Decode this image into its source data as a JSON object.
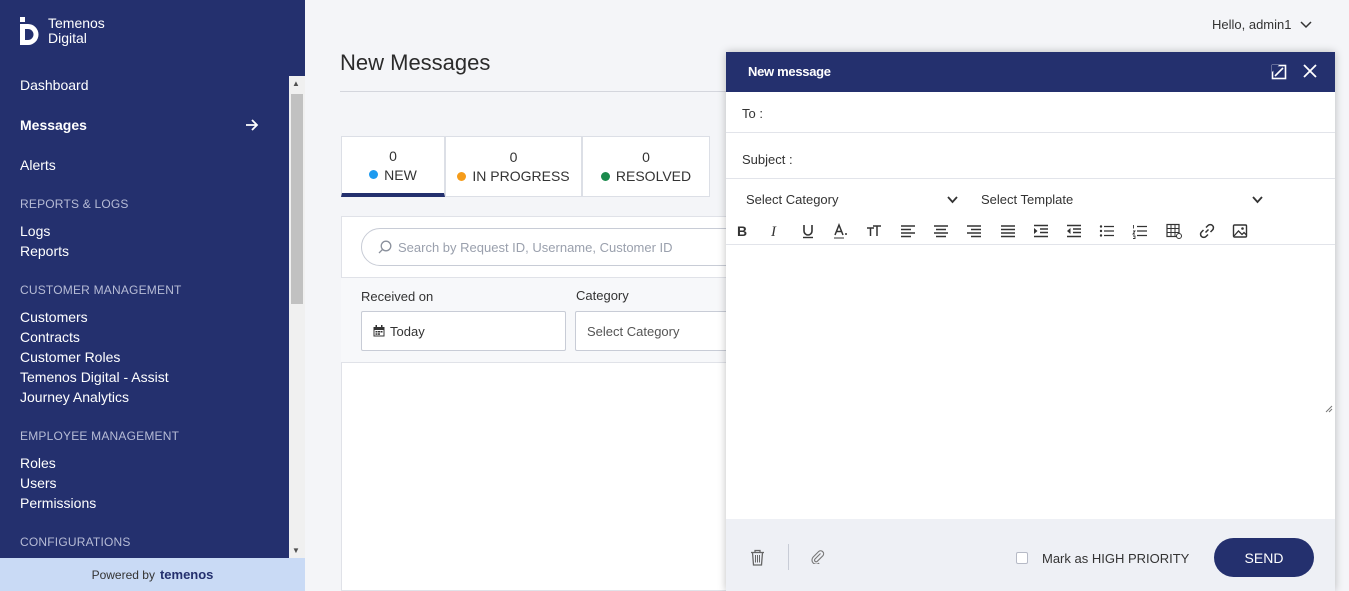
{
  "brand": {
    "line1": "Temenos",
    "line2": "Digital",
    "powered_prefix": "Powered by",
    "powered_brand": "temenos"
  },
  "nav": {
    "top": [
      {
        "label": "Dashboard"
      },
      {
        "label": "Messages",
        "active": true
      },
      {
        "label": "Alerts"
      }
    ],
    "sections": [
      {
        "title": "REPORTS & LOGS",
        "items": [
          "Logs",
          "Reports"
        ]
      },
      {
        "title": "CUSTOMER MANAGEMENT",
        "items": [
          "Customers",
          "Contracts",
          "Customer Roles",
          "Temenos Digital - Assist",
          "Journey Analytics"
        ]
      },
      {
        "title": "EMPLOYEE MANAGEMENT",
        "items": [
          "Roles",
          "Users",
          "Permissions"
        ]
      },
      {
        "title": "CONFIGURATIONS",
        "items": []
      }
    ]
  },
  "header": {
    "greeting": "Hello, admin1"
  },
  "page": {
    "title": "New Messages"
  },
  "tabs": [
    {
      "count": "0",
      "label": "NEW",
      "color": "#1e9bf0"
    },
    {
      "count": "0",
      "label": "IN PROGRESS",
      "color": "#f59c1a"
    },
    {
      "count": "0",
      "label": "RESOLVED",
      "color": "#1b8a4c"
    }
  ],
  "search": {
    "placeholder": "Search by Request ID, Username, Customer ID"
  },
  "filters": {
    "received_label": "Received on",
    "received_value": "Today",
    "category_label": "Category",
    "category_value": "Select Category"
  },
  "modal": {
    "title": "New message",
    "to_label": "To :",
    "subject_label": "Subject :",
    "category_select": "Select Category",
    "template_select": "Select Template",
    "priority_label": "Mark as HIGH PRIORITY",
    "send_label": "SEND"
  },
  "colors": {
    "navy": "#24306e",
    "powered_bg": "#c9daf5"
  }
}
